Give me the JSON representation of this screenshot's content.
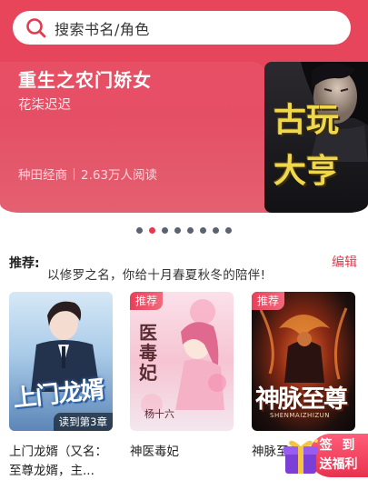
{
  "search": {
    "placeholder": "搜索书名/角色"
  },
  "banner": {
    "title": "重生之农门娇女",
    "author": "花柒迟迟",
    "category": "种田经商",
    "readers": "2.63万人阅读",
    "cover_text_1": "古玩",
    "cover_text_2": "大亨"
  },
  "carousel": {
    "count": 8,
    "active_index": 1
  },
  "recommend": {
    "label": "推荐:",
    "text": "以修罗之名，你给十月春夏秋冬的陪伴!",
    "edit_label": "编辑"
  },
  "books": [
    {
      "title": "上门龙婿（又名：至尊龙婿，主...",
      "title_line1": "上门龙婿（又名：",
      "title_line2": "至尊龙婿，主...",
      "progress": "读到第3章",
      "cover_text": "上门龙婿",
      "tag": ""
    },
    {
      "title": "神医毒妃",
      "progress": "",
      "cover_text": "医毒妃",
      "cover_author": "杨十六",
      "tag": "推荐"
    },
    {
      "title": "神脉至尊",
      "progress": "",
      "cover_text": "神脉至尊",
      "cover_sub": "SHENMAIZHIZUN",
      "tag": "推荐"
    }
  ],
  "welfare": {
    "line1": "签 到",
    "line2": "送福利"
  },
  "colors": {
    "accent": "#e23a4e",
    "hero": "#e8455b",
    "cover_gold": "#f0d84c"
  }
}
